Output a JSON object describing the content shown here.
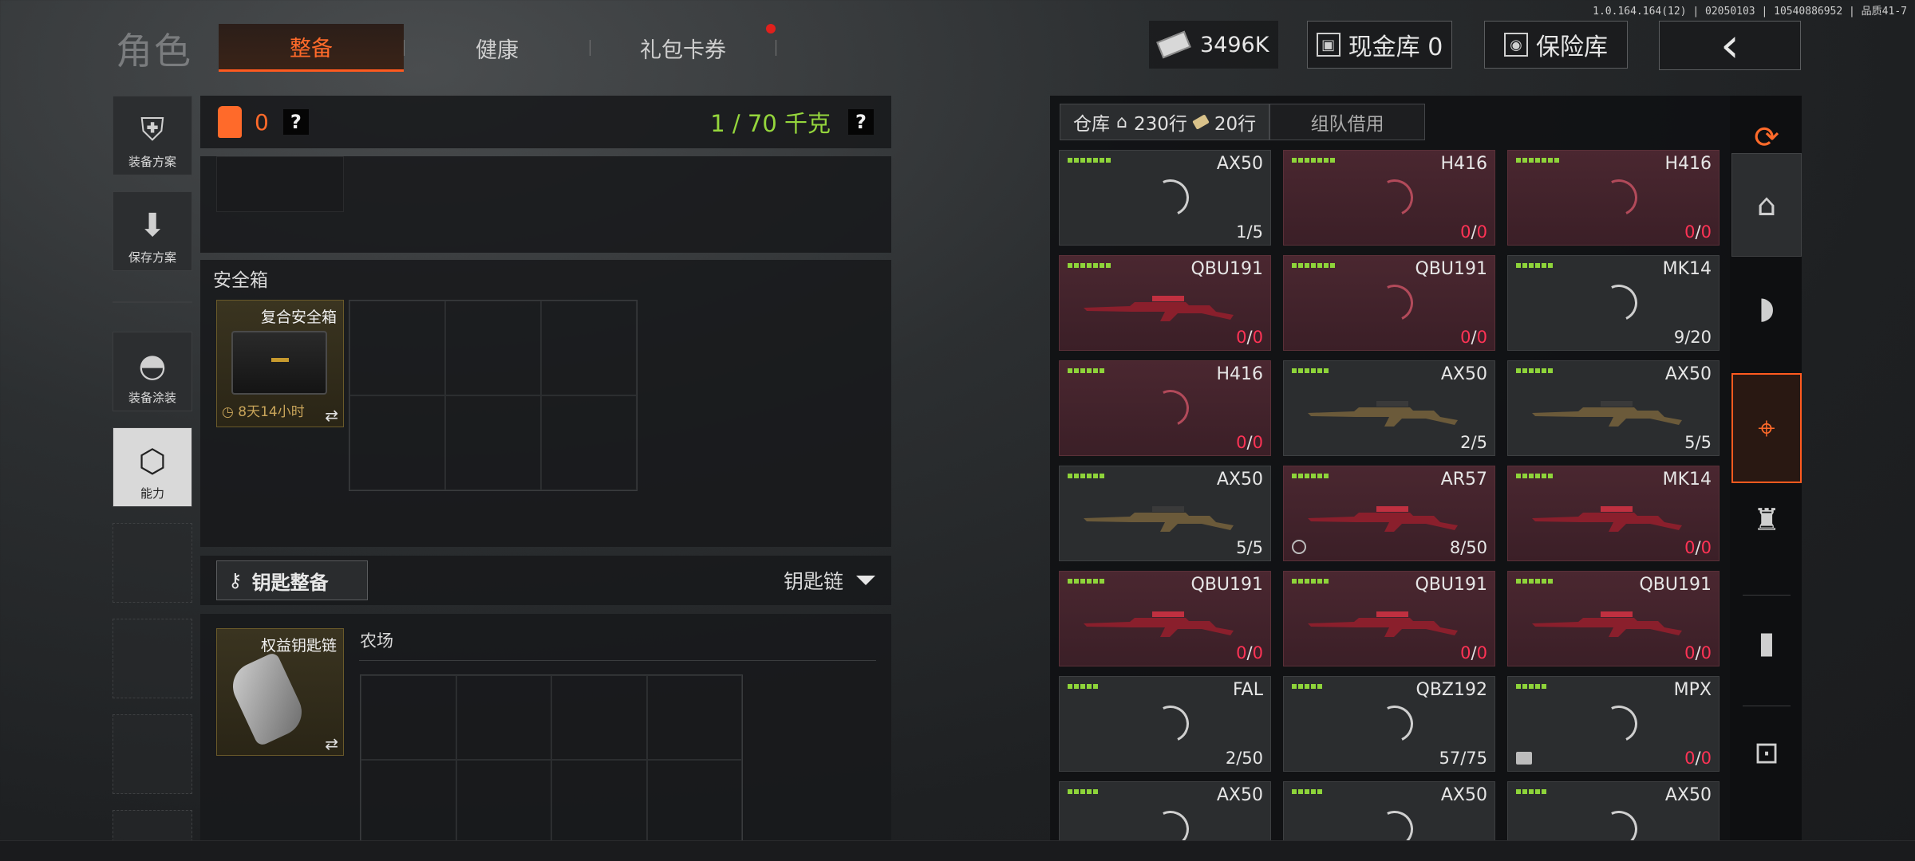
{
  "version": "1.0.164.164(12) | 02050103 | 10540886952 | 品质41-7",
  "header": {
    "title": "角色",
    "tabs": [
      {
        "label": "整备",
        "active": true
      },
      {
        "label": "健康",
        "active": false
      },
      {
        "label": "礼包卡券",
        "active": false,
        "badge": true
      }
    ],
    "cash": "3496K",
    "cash_vault": "现金库 0",
    "vault": "保险库",
    "back_icon": "chevron-left-icon"
  },
  "side_nav": [
    {
      "label": "装备方案",
      "icon": "vest-icon"
    },
    {
      "label": "保存方案",
      "icon": "download-icon"
    },
    {
      "label": "装备涂装",
      "icon": "helmet-icon"
    },
    {
      "label": "能力",
      "icon": "ability-icon",
      "active": true
    }
  ],
  "loadout": {
    "count": "0",
    "help": "?",
    "weight": "1 / 70 千克"
  },
  "safe_box": {
    "label": "安全箱",
    "item_name": "复合安全箱",
    "timer": "8天14小时",
    "swap": "⇄"
  },
  "keys": {
    "button": "钥匙整备",
    "dropdown": "钥匙链",
    "item_name": "权益钥匙链",
    "area": "农场",
    "swap": "⇄"
  },
  "warehouse": {
    "tab_label": "仓库",
    "rows": "230行",
    "tags": "20行",
    "team_tab": "组队借用",
    "accent": "#ff6a2a",
    "cells": [
      {
        "name": "AX50",
        "count": "1/5",
        "red": false,
        "rarity": 7,
        "gun": false,
        "zero": false
      },
      {
        "name": "H416",
        "count": "0/0",
        "red": true,
        "rarity": 7,
        "gun": false,
        "zero": true
      },
      {
        "name": "H416",
        "count": "0/0",
        "red": true,
        "rarity": 7,
        "gun": false,
        "zero": true
      },
      {
        "name": "QBU191",
        "count": "0/0",
        "red": true,
        "rarity": 7,
        "gun": true,
        "zero": true
      },
      {
        "name": "QBU191",
        "count": "0/0",
        "red": true,
        "rarity": 7,
        "gun": false,
        "zero": true
      },
      {
        "name": "MK14",
        "count": "9/20",
        "red": false,
        "rarity": 6,
        "gun": false,
        "zero": false
      },
      {
        "name": "H416",
        "count": "0/0",
        "red": true,
        "rarity": 6,
        "gun": false,
        "zero": true
      },
      {
        "name": "AX50",
        "count": "2/5",
        "red": false,
        "rarity": 6,
        "gun": true,
        "zero": false
      },
      {
        "name": "AX50",
        "count": "5/5",
        "red": false,
        "rarity": 6,
        "gun": true,
        "zero": false
      },
      {
        "name": "AX50",
        "count": "5/5",
        "red": false,
        "rarity": 6,
        "gun": true,
        "zero": false
      },
      {
        "name": "AR57",
        "count": "8/50",
        "red": true,
        "rarity": 6,
        "gun": true,
        "zero": false,
        "shield": true
      },
      {
        "name": "MK14",
        "count": "0/0",
        "red": true,
        "rarity": 6,
        "gun": true,
        "zero": true
      },
      {
        "name": "QBU191",
        "count": "0/0",
        "red": true,
        "rarity": 6,
        "gun": true,
        "zero": true
      },
      {
        "name": "QBU191",
        "count": "0/0",
        "red": true,
        "rarity": 6,
        "gun": true,
        "zero": true
      },
      {
        "name": "QBU191",
        "count": "0/0",
        "red": true,
        "rarity": 6,
        "gun": true,
        "zero": true
      },
      {
        "name": "FAL",
        "count": "2/50",
        "red": false,
        "rarity": 5,
        "gun": false,
        "zero": false
      },
      {
        "name": "QBZ192",
        "count": "57/75",
        "red": false,
        "rarity": 5,
        "gun": false,
        "zero": false
      },
      {
        "name": "MPX",
        "count": "0/0",
        "red": false,
        "rarity": 5,
        "gun": false,
        "zero": true,
        "box": true
      },
      {
        "name": "AX50",
        "count": "",
        "red": false,
        "rarity": 5,
        "gun": false,
        "zero": false
      },
      {
        "name": "AX50",
        "count": "",
        "red": false,
        "rarity": 5,
        "gun": false,
        "zero": false
      },
      {
        "name": "AX50",
        "count": "",
        "red": false,
        "rarity": 5,
        "gun": false,
        "zero": false
      }
    ]
  },
  "right_nav": [
    {
      "name": "stack-refresh-icon",
      "glyph": "⟳"
    },
    {
      "name": "home-icon",
      "glyph": "⌂"
    },
    {
      "name": "helmet-icon",
      "glyph": "◗"
    },
    {
      "name": "rifle-icon",
      "glyph": "⌖"
    },
    {
      "name": "grenade-icon",
      "glyph": "♜"
    },
    {
      "name": "bullet-icon",
      "glyph": "▮"
    },
    {
      "name": "scope-icon",
      "glyph": "⊡"
    }
  ]
}
